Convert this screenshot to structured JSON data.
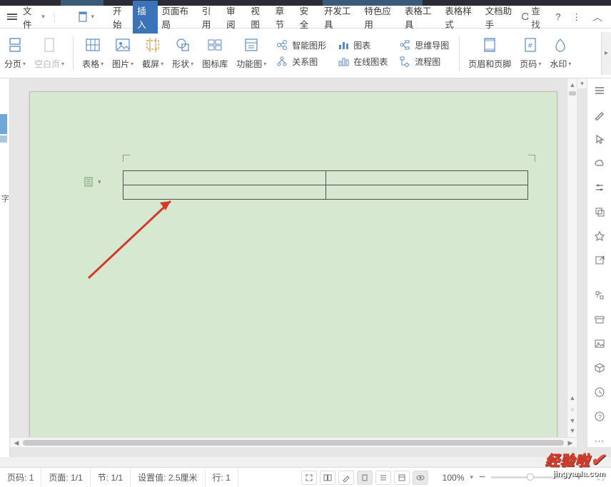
{
  "menu": {
    "file": "文件",
    "tabs": [
      "开始",
      "插入",
      "页面布局",
      "引用",
      "审阅",
      "视图",
      "章节",
      "安全",
      "开发工具",
      "特色应用",
      "表格工具",
      "表格样式",
      "文档助手"
    ],
    "active_tab_index": 1,
    "search": "查找",
    "help": "?",
    "more": "⋮"
  },
  "ribbon": {
    "paging": "分页",
    "blank_page": "空白页",
    "table": "表格",
    "picture": "图片",
    "screenshot": "截屏",
    "shapes": "形状",
    "icon_lib": "图标库",
    "func_chart": "功能图",
    "smart_graphic": "智能图形",
    "chart": "图表",
    "mind_map": "思维导图",
    "relation": "关系图",
    "online_chart": "在线图表",
    "flowchart": "流程图",
    "header_footer": "页眉和页脚",
    "page_number": "页码",
    "watermark": "水印"
  },
  "gutter": {
    "char": "字"
  },
  "status": {
    "page_no_label": "页码:",
    "page_no_val": "1",
    "page_label": "页面:",
    "page_val": "1/1",
    "section_label": "节:",
    "section_val": "1/1",
    "pos_label": "设置值:",
    "pos_val": "2.5厘米",
    "line_label": "行:",
    "line_val": "1",
    "zoom": "100%"
  },
  "watermark": {
    "line1": "经验啦",
    "line2": "jingyanla.com"
  }
}
